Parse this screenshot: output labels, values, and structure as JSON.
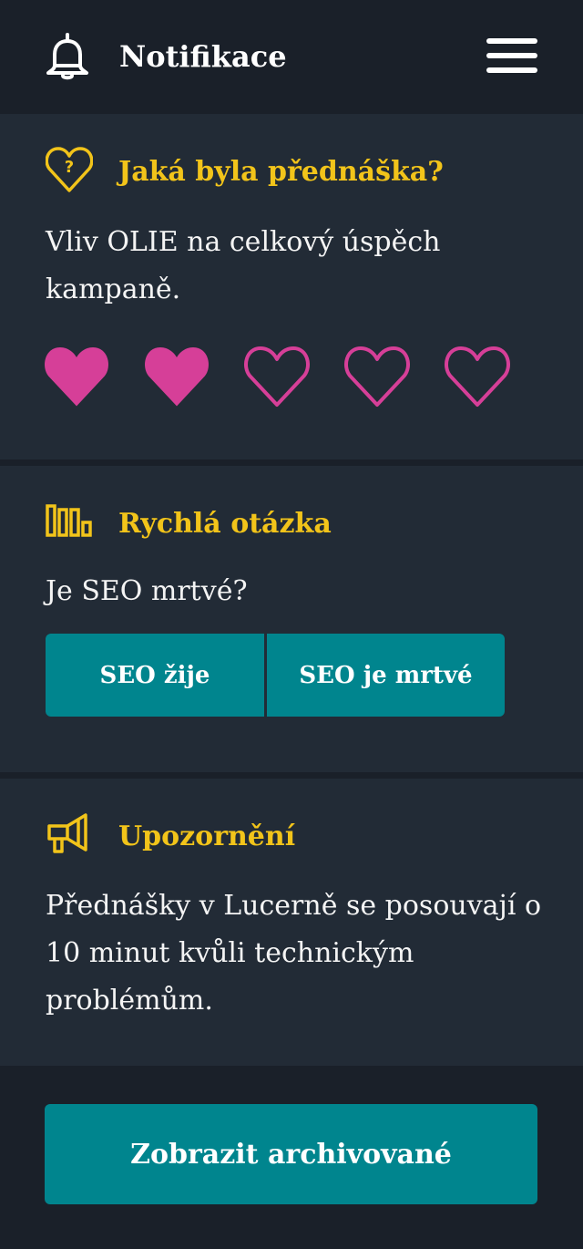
{
  "header": {
    "title": "Notifikace",
    "bell_icon": "bell-icon",
    "menu_icon": "hamburger-menu-icon"
  },
  "rating_card": {
    "icon": "heart-question-icon",
    "heading": "Jaká byla přednáška?",
    "text": "Vliv OLIE na celkový úspěch kampaně.",
    "rating": {
      "value": 2,
      "max": 5
    },
    "accent_color": "#d63f98"
  },
  "poll_card": {
    "icon": "bar-chart-icon",
    "heading": "Rychlá otázka",
    "question": "Je SEO mrtvé?",
    "options": [
      "SEO žije",
      "SEO je mrtvé"
    ]
  },
  "notice_card": {
    "icon": "megaphone-icon",
    "heading": "Upozornění",
    "text": "Přednášky v Lucerně se posouvají o 10 minut kvůli technickým problémům."
  },
  "archive_button": {
    "label": "Zobrazit archivované"
  },
  "colors": {
    "background": "#1a2029",
    "card": "#222b36",
    "heading_yellow": "#f2c41a",
    "button_teal": "#00858e",
    "heart_pink": "#d63f98"
  }
}
